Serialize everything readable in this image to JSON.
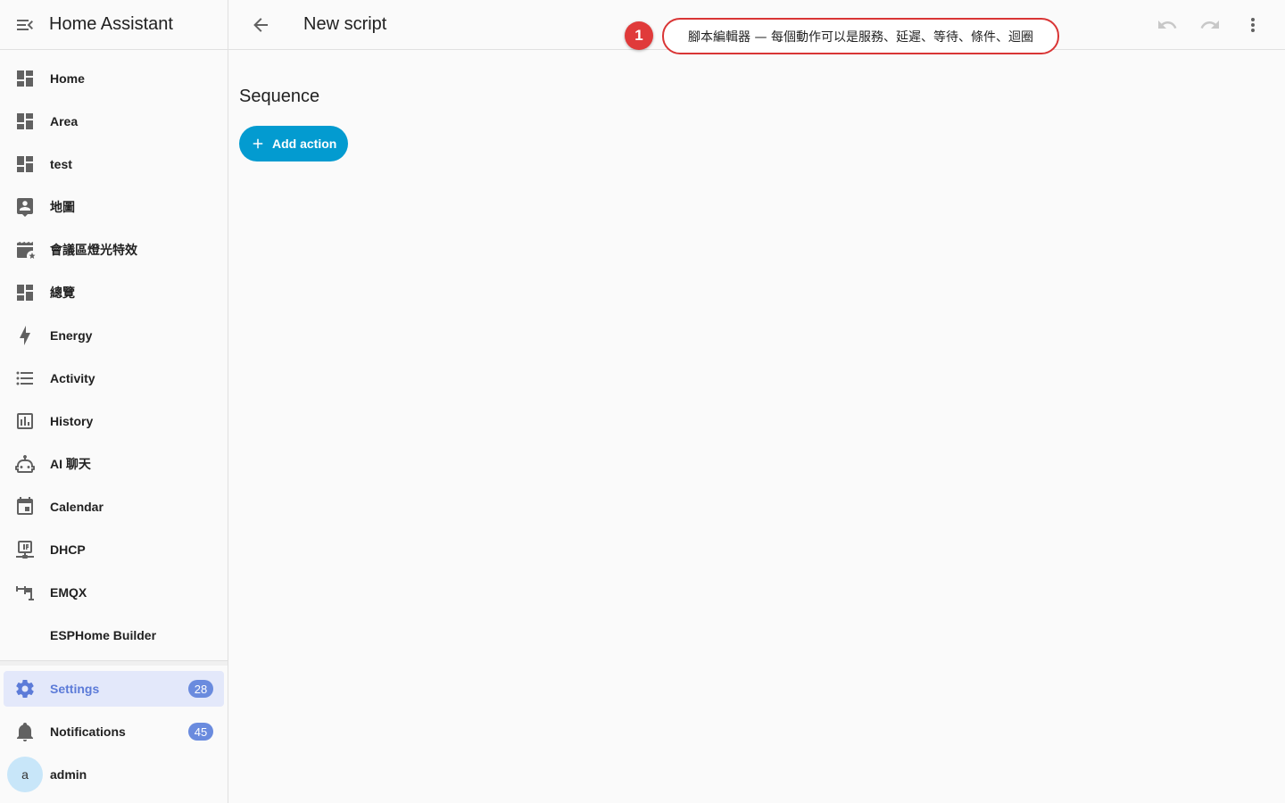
{
  "app": {
    "title": "Home Assistant"
  },
  "sidebar": {
    "items": [
      {
        "label": "Home",
        "icon": "dashboard-icon"
      },
      {
        "label": "Area",
        "icon": "dashboard-icon"
      },
      {
        "label": "test",
        "icon": "dashboard-icon"
      },
      {
        "label": "地圖",
        "icon": "map-person-icon"
      },
      {
        "label": "會議區燈光特效",
        "icon": "movie-clapper-icon"
      },
      {
        "label": "總覽",
        "icon": "dashboard-icon"
      },
      {
        "label": "Energy",
        "icon": "lightning-bolt-icon"
      },
      {
        "label": "Activity",
        "icon": "format-list-icon"
      },
      {
        "label": "History",
        "icon": "chart-box-icon"
      },
      {
        "label": "AI 聊天",
        "icon": "robot-icon"
      },
      {
        "label": "Calendar",
        "icon": "calendar-icon"
      },
      {
        "label": "DHCP",
        "icon": "ip-network-icon"
      },
      {
        "label": "EMQX",
        "icon": "pipe-icon"
      },
      {
        "label": "ESPHome Builder",
        "icon": ""
      }
    ],
    "settings": {
      "label": "Settings",
      "badge": "28"
    },
    "notifications": {
      "label": "Notifications",
      "badge": "45"
    },
    "user": {
      "label": "admin",
      "avatar": "a"
    }
  },
  "topbar": {
    "title": "New script"
  },
  "main": {
    "section_title": "Sequence",
    "add_action_label": "Add action"
  },
  "annotation": {
    "number": "1",
    "text": "腳本編輯器 — 每個動作可以是服務、延遲、等待、條件、迴圈"
  },
  "colors": {
    "accent": "#039bd0",
    "badge": "#6a8bde",
    "active_bg": "#e3e8fa",
    "annotation_red": "#e03a3a",
    "icon_gray": "#616161"
  }
}
